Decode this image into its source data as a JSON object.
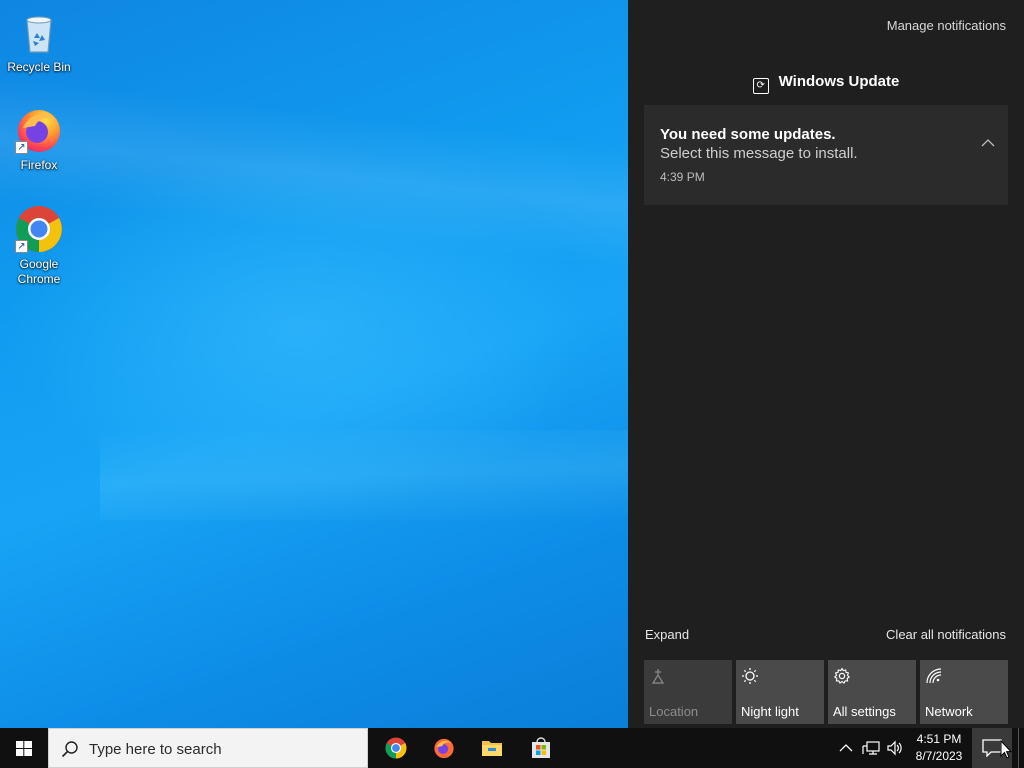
{
  "desktop": {
    "icons": [
      {
        "label": "Recycle Bin",
        "icon": "recycle-bin-icon"
      },
      {
        "label": "Firefox",
        "icon": "firefox-icon"
      },
      {
        "label": "Google\nChrome",
        "icon": "chrome-icon"
      }
    ]
  },
  "action_center": {
    "manage_label": "Manage notifications",
    "group_title": "Windows Update",
    "notification": {
      "title": "You need some updates.",
      "body": "Select this message to install.",
      "time": "4:39 PM"
    },
    "expand_label": "Expand",
    "clear_label": "Clear all notifications",
    "quick_actions": [
      {
        "label": "Location",
        "icon": "location-icon",
        "enabled": false
      },
      {
        "label": "Night light",
        "icon": "night-light-icon",
        "enabled": true
      },
      {
        "label": "All settings",
        "icon": "gear-icon",
        "enabled": true
      },
      {
        "label": "Network",
        "icon": "network-icon",
        "enabled": true
      }
    ]
  },
  "taskbar": {
    "search_placeholder": "Type here to search",
    "pinned": [
      "chrome-icon",
      "firefox-icon",
      "file-explorer-icon",
      "microsoft-store-icon"
    ],
    "clock_time": "4:51 PM",
    "clock_date": "8/7/2023"
  },
  "colors": {
    "action_center_bg": "#1f1f1f",
    "notification_bg": "#2b2b2b",
    "tile_bg": "#4a4a4a",
    "taskbar_bg": "#101010",
    "desktop_blue": "#109cf0"
  }
}
